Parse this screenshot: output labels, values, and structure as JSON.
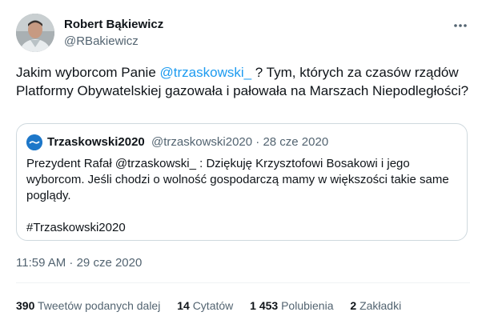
{
  "author": {
    "name": "Robert Bąkiewicz",
    "handle": "@RBakiewicz"
  },
  "tweet": {
    "text_before": "Jakim wyborcom Panie ",
    "mention": "@trzaskowski_",
    "text_after": " ? Tym, których za czasów rządów Platformy Obywatelskiej gazowała i pałowała na Marszach Niepodległości?"
  },
  "quoted": {
    "name": "Trzaskowski2020",
    "handle_date": "@trzaskowski2020 · 28 cze 2020",
    "text": "Prezydent Rafał @trzaskowski_ : Dziękuję Krzysztofowi Bosakowi i jego wyborcom. Jeśli chodzi o wolność gospodarczą mamy w większości takie same poglądy.",
    "hashtag": "#Trzaskowski2020"
  },
  "timestamp": "11:59 AM · 29 cze 2020",
  "stats": {
    "retweets_count": "390",
    "retweets_label": "Tweetów podanych dalej",
    "quotes_count": "14",
    "quotes_label": "Cytatów",
    "likes_count": "1 453",
    "likes_label": "Polubienia",
    "bookmarks_count": "2",
    "bookmarks_label": "Zakładki"
  },
  "icons": {
    "more": "more-options-icon",
    "quote_avatar": "trzaskowski2020-logo"
  },
  "colors": {
    "link": "#1d9bf0",
    "muted": "#536471",
    "text": "#0f1419",
    "border": "#cfd9de"
  }
}
